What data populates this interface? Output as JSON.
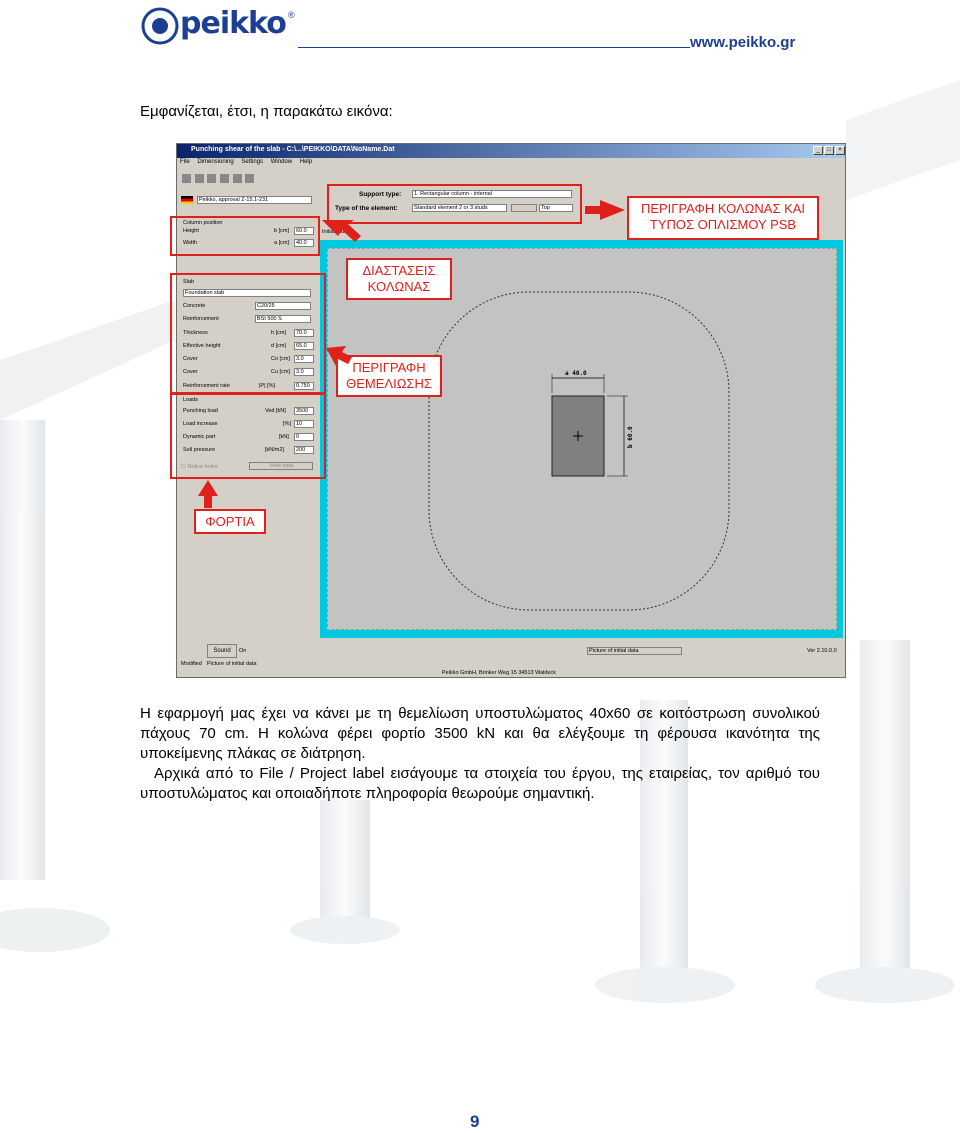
{
  "header": {
    "logo_text": "peikko",
    "url": "www.peikko.gr"
  },
  "intro": "Εμφανίζεται, έτσι, η παρακάτω εικόνα:",
  "app": {
    "title": "Punching shear of the slab - C:\\...\\PEIKKO\\DATA\\NoName.Dat",
    "menu": [
      "File",
      "Dimensioning",
      "Settings",
      "Window",
      "Help"
    ],
    "approval": "Peikko, approval Z-15.1-231",
    "support_type_label": "Support type:",
    "support_type_value": "1. Rectangular column - internal",
    "element_type_label": "Type of the element:",
    "element_type_value": "Standard element 2 or 3 studs",
    "element_pos": "Top",
    "initial_data_tab": "Initial data",
    "column_position": {
      "title": "Column position",
      "height_label": "Height",
      "height_unit": "b [cm]",
      "height_value": "60.0",
      "width_label": "Width",
      "width_unit": "a [cm]",
      "width_value": "40.0"
    },
    "slab": {
      "title": "Slab",
      "type": "Foundation slab",
      "concrete_label": "Concrete",
      "concrete_value": "C20/25",
      "reinf_label": "Reinforcement",
      "reinf_value": "BSt 500 S",
      "thickness_label": "Thickness",
      "thickness_unit": "h [cm]",
      "thickness_value": "70.0",
      "eff_label": "Effective height",
      "eff_unit": "d [cm]",
      "eff_value": "65.0",
      "cover1_label": "Cover",
      "cover1_unit": "Co [cm]",
      "cover1_value": "3.0",
      "cover2_label": "Cover",
      "cover2_unit": "Cu [cm]",
      "cover2_value": "3.0",
      "rate_label": "Reinforcement rate",
      "rate_unit": "|P| [%]",
      "rate_value": "0.750"
    },
    "loads": {
      "title": "Loads",
      "punch_label": "Punching load",
      "punch_unit": "Ved [kN]",
      "punch_value": "3500",
      "inc_label": "Load increase",
      "inc_unit": "[%]",
      "inc_value": "10",
      "dyn_label": "Dynamic part",
      "dyn_unit": "[kN]",
      "dyn_value": "0",
      "soil_label": "Soil pressure",
      "soil_unit": "[kN/m2]",
      "soil_value": "200"
    },
    "notice_holes": "Notice holes",
    "hole_data": "Hole data",
    "dim_a": "a 40.0",
    "dim_b": "b 60.0",
    "sound_label": "Sound",
    "sound_state": "On",
    "status_modified": "Modified",
    "status_picture": "Picture of initial data",
    "status_picture_btn": "Picture of initial data",
    "status_version": "Ver 2.10.0.0",
    "status_address": "Peikko GmbH, Brinker Weg 15 34513 Waldeck"
  },
  "annotations": {
    "column_type": [
      "ΠΕΡΙΓΡΑΦΗ ΚΟΛΩΝΑΣ ΚΑΙ",
      "ΤΥΠΟΣ ΟΠΛΙΣΜΟΥ PSB"
    ],
    "column_dims": [
      "ΔΙΑΣΤΑΣΕΙΣ",
      "ΚΟΛΩΝΑΣ"
    ],
    "foundation": [
      "ΠΕΡΙΓΡΑΦΗ",
      "ΘΕΜΕΛΙΩΣΗΣ"
    ],
    "loads": "ΦΟΡΤΙΑ"
  },
  "body": {
    "p1": "Η εφαρμογή μας έχει να κάνει με τη θεμελίωση υποστυλώματος 40x60 σε κοιτόστρωση συνολικού πάχους 70 cm. Η κολώνα φέρει φορτίο 3500 kN και θα ελέγξουμε τη φέρουσα ικανότητα της υποκείμενης πλάκας σε διάτρηση.",
    "p2": "Αρχικά από το File / Project label εισάγουμε τα στοιχεία του έργου, της εταιρείας, τον αριθμό του υποστυλώματος και οποιαδήποτε πληροφορία θεωρούμε σημαντική."
  },
  "page_number": "9",
  "colors": {
    "brand": "#1c3f94",
    "annotation": "#e0201b",
    "canvas_frame": "#00c8e0"
  }
}
